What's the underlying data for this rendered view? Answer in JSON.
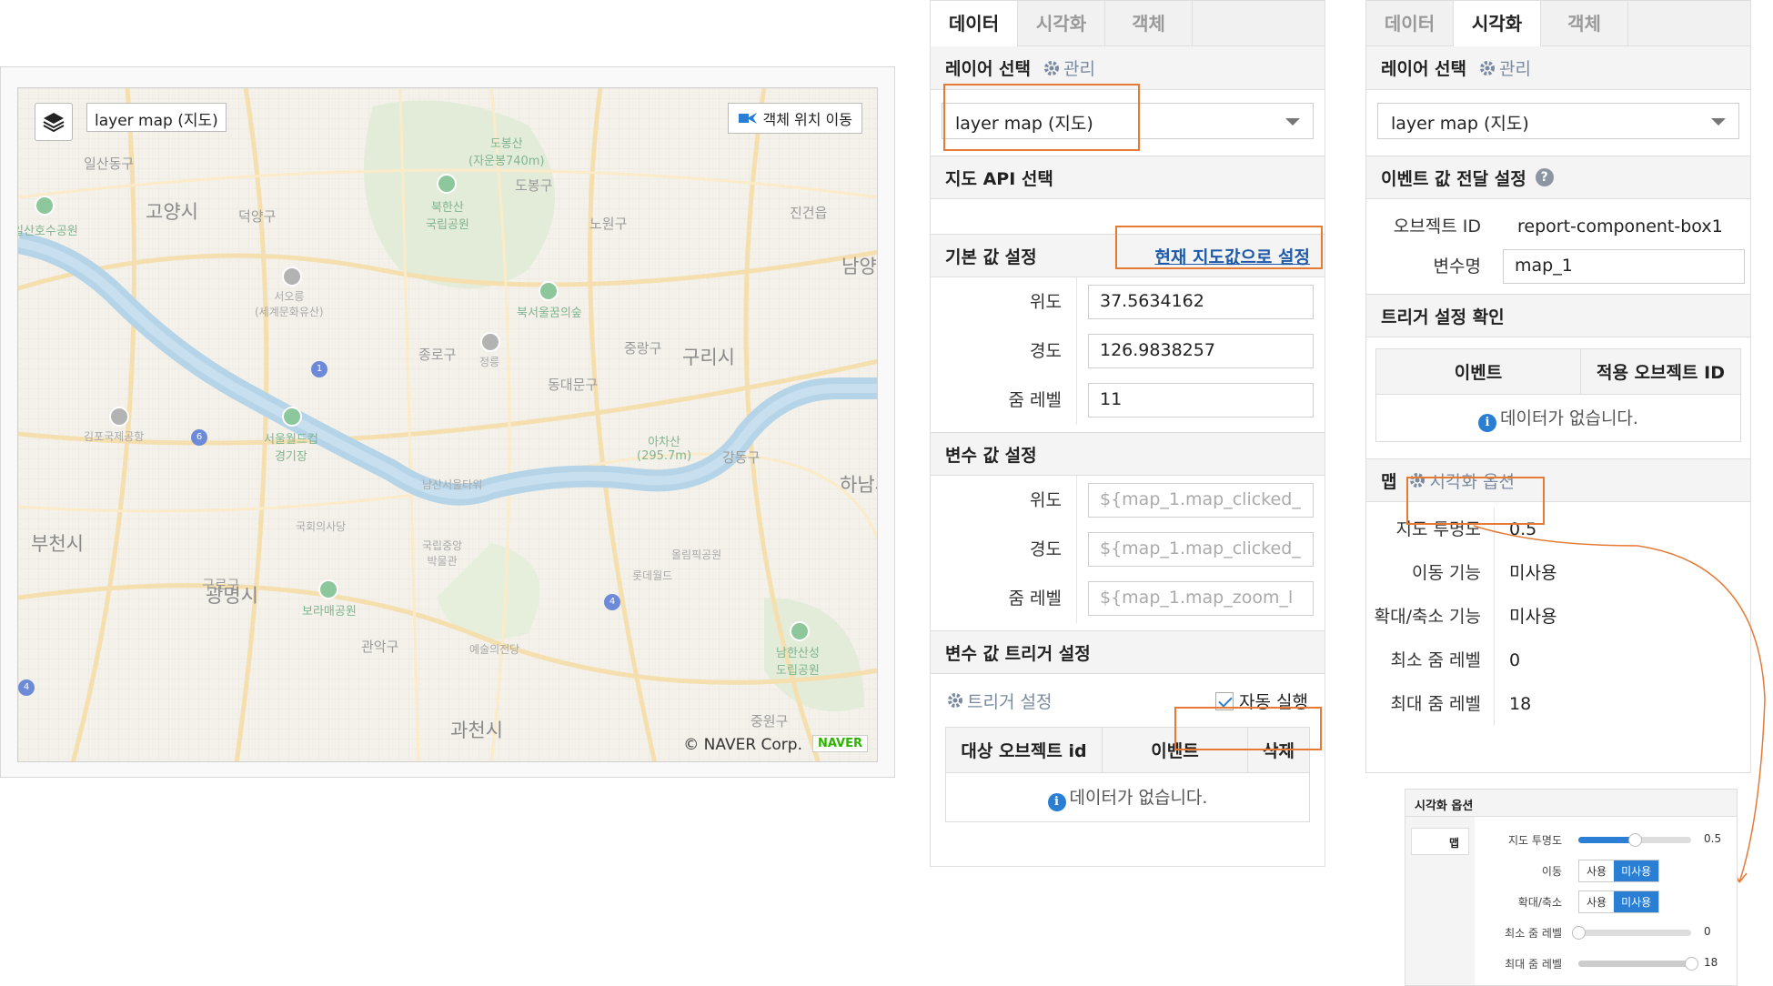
{
  "map": {
    "layer_name": "layer map (지도)",
    "move_button": "객체 위치 이동",
    "copyright": "© NAVER Corp.",
    "logo": "NAVER",
    "labels": {
      "goyang": "고양시",
      "bucheon": "부천시",
      "gwangmyeong": "광명시",
      "gwacheon": "과천시",
      "guri": "구리시",
      "namyang": "남양",
      "hanam": "하남시",
      "ilsan": "일산동구",
      "deogyang": "덕양구",
      "dobong": "도봉구",
      "nowon": "노원구",
      "jongno": "종로구",
      "jungnang": "중랑구",
      "dongdaemun": "동대문구",
      "gangdong": "강동구",
      "guro": "구로구",
      "gwanak": "관악구",
      "jinjeop": "진건읍",
      "jungwon": "중원구",
      "dobongsan": "도봉산\n(자운봉740m)",
      "bukhansan": "북한산\n국립공원",
      "seooreung": "서오릉\n(세계문화유산)",
      "bukseoul": "북서울꿈의숲",
      "jeongneung": "정릉",
      "seoulworldcup": "서울월드컵\n경기장",
      "gimpo_airport": "김포국제공항",
      "namsan": "남산서울타워",
      "national_assembly": "국회의사당",
      "museum": "국립중앙\n박물관",
      "boramae": "보라매공원",
      "arts_center": "예술의전당",
      "olympic": "올림픽공원",
      "lotte": "롯데월드",
      "achasan": "아차산\n(295.7m)",
      "namhansan": "남한산성\n도립공원",
      "ilsan_lake": "일산호수공원"
    }
  },
  "panel1": {
    "tabs": [
      "데이터",
      "시각화",
      "객체"
    ],
    "layer_section": {
      "title": "레이어 선택",
      "manage": "관리",
      "selected": "layer map (지도)"
    },
    "api_section": {
      "title": "지도 API 선택"
    },
    "default_section": {
      "title": "기본 값 설정",
      "action": "현재 지도값으로 설정",
      "fields": [
        {
          "label": "위도",
          "value": "37.5634162"
        },
        {
          "label": "경도",
          "value": "126.9838257"
        },
        {
          "label": "줌 레벨",
          "value": "11"
        }
      ]
    },
    "variable_section": {
      "title": "변수 값 설정",
      "fields": [
        {
          "label": "위도",
          "value": "${map_1.map_clicked_"
        },
        {
          "label": "경도",
          "value": "${map_1.map_clicked_"
        },
        {
          "label": "줌 레벨",
          "value": "${map_1.map_zoom_l"
        }
      ]
    },
    "trigger_section": {
      "title": "변수 값 트리거 설정",
      "settings": "트리거 설정",
      "auto_run": "자동 실행",
      "columns": [
        "대상 오브젝트 id",
        "이벤트",
        "삭제"
      ],
      "empty": "데이터가 없습니다."
    }
  },
  "panel2": {
    "tabs": [
      "데이터",
      "시각화",
      "객체"
    ],
    "layer_section": {
      "title": "레이어 선택",
      "manage": "관리",
      "selected": "layer map (지도)"
    },
    "event_section": {
      "title": "이벤트 값 전달 설정",
      "help": "?",
      "object_id_label": "오브젝트 ID",
      "object_id": "report-component-box1",
      "var_name_label": "변수명",
      "var_name": "map_1"
    },
    "trigger_check": {
      "title": "트리거 설정 확인",
      "columns": [
        "이벤트",
        "적용 오브젝트 ID"
      ],
      "empty": "데이터가 없습니다."
    },
    "map_section": {
      "title": "맵",
      "options": "시각화 옵션",
      "rows": [
        {
          "label": "지도 투명도",
          "value": "0.5"
        },
        {
          "label": "이동 기능",
          "value": "미사용"
        },
        {
          "label": "확대/축소 기능",
          "value": "미사용"
        },
        {
          "label": "최소 줌 레벨",
          "value": "0"
        },
        {
          "label": "최대 줌 레벨",
          "value": "18"
        }
      ]
    }
  },
  "mini": {
    "title": "시각화 옵션",
    "tab": "맵",
    "opacity_label": "지도 투명도",
    "opacity_value": "0.5",
    "opacity_level": 0.5,
    "move_label": "이동",
    "zoom_label": "확대/축소",
    "use": "사용",
    "unused": "미사용",
    "min_label": "최소 줌 레벨",
    "min_value": "0",
    "min_level": 0,
    "max_label": "최대 줌 레벨",
    "max_value": "18",
    "max_level": 1
  },
  "colors": {
    "accent": "#e57a35",
    "blue": "#2a7fd4",
    "river": "#a7cbe3",
    "road": "#f3d9a4"
  }
}
